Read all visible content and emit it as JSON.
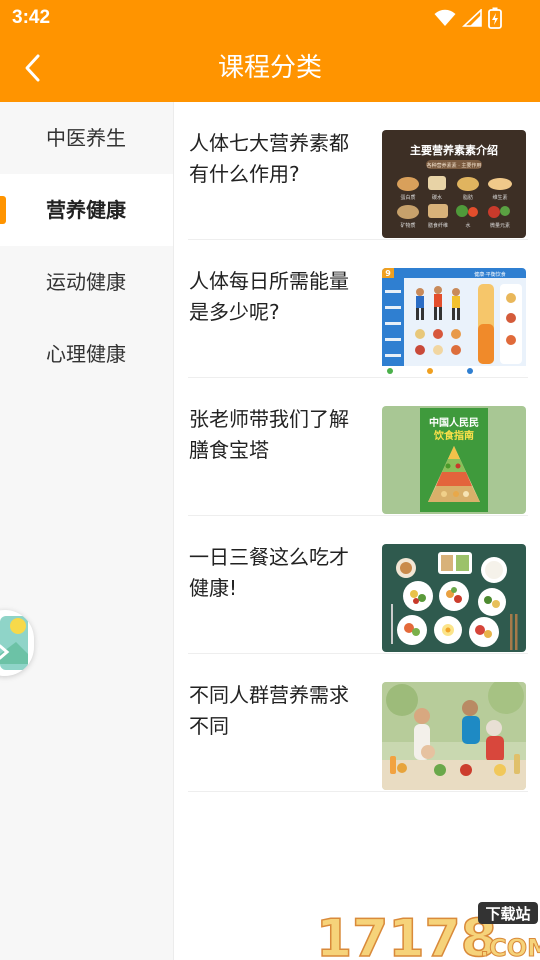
{
  "status_bar": {
    "time": "3:42",
    "icons": [
      "wifi-icon",
      "signal-icon",
      "battery-charging-icon"
    ]
  },
  "header": {
    "title": "课程分类",
    "back_icon": "chevron-left-icon"
  },
  "sidebar": {
    "items": [
      {
        "label": "中医养生",
        "active": false
      },
      {
        "label": "营养健康",
        "active": true
      },
      {
        "label": "运动健康",
        "active": false
      },
      {
        "label": "心理健康",
        "active": false
      }
    ]
  },
  "courses": [
    {
      "title": "人体七大营养素都有什么作用?",
      "thumb": {
        "heading": "主要营养素素介绍",
        "subheading": "各种营养素素 · 主要作用",
        "labels": [
          "蛋白质",
          "碳水",
          "脂肪",
          "维生素",
          "矿物质",
          "膳食纤维",
          "水",
          "微量元素"
        ]
      }
    },
    {
      "title": "人体每日所需能量是多少呢?",
      "thumb": {
        "badge": "9",
        "heading": "健康·平衡饮食"
      }
    },
    {
      "title": "张老师带我们了解膳食宝塔",
      "thumb": {
        "heading_line1": "中国人民民",
        "heading_line2": "饮食指南"
      }
    },
    {
      "title": "一日三餐这么吃才健康!",
      "thumb": {}
    },
    {
      "title": "不同人群营养需求不同",
      "thumb": {}
    }
  ],
  "watermark": {
    "digits": "17178",
    "badge": "下载站",
    "suffix": ".COM"
  },
  "colors": {
    "accent": "#ff9400",
    "sidebar_bg": "#f7f7f7",
    "text": "#222222"
  }
}
